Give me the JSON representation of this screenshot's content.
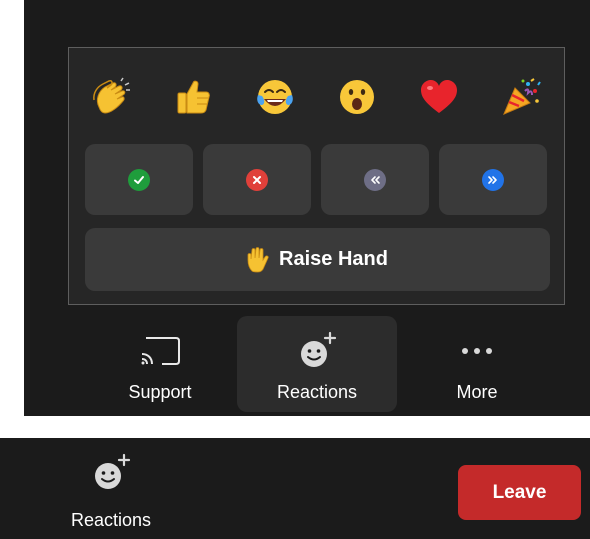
{
  "reactions_popup": {
    "emojis": [
      "clapping-hands",
      "thumbs-up",
      "tears-of-joy",
      "open-mouth",
      "red-heart",
      "party-popper"
    ],
    "feedback": [
      "yes-check",
      "no-cross",
      "slow-down",
      "speed-up"
    ],
    "raise_hand_label": "Raise Hand"
  },
  "toolbar": {
    "support_label": "Support",
    "reactions_label": "Reactions",
    "more_label": "More"
  },
  "bottom_bar": {
    "reactions_label": "Reactions",
    "leave_label": "Leave"
  },
  "colors": {
    "panel_bg": "#1b1b1b",
    "popup_bg": "#262626",
    "button_bg": "#3a3a3a",
    "leave_red": "#c42a2a",
    "check_green": "#1f9d3c",
    "cross_red": "#e0403a",
    "slow_gray": "#6e6e86",
    "fast_blue": "#2173e8"
  }
}
